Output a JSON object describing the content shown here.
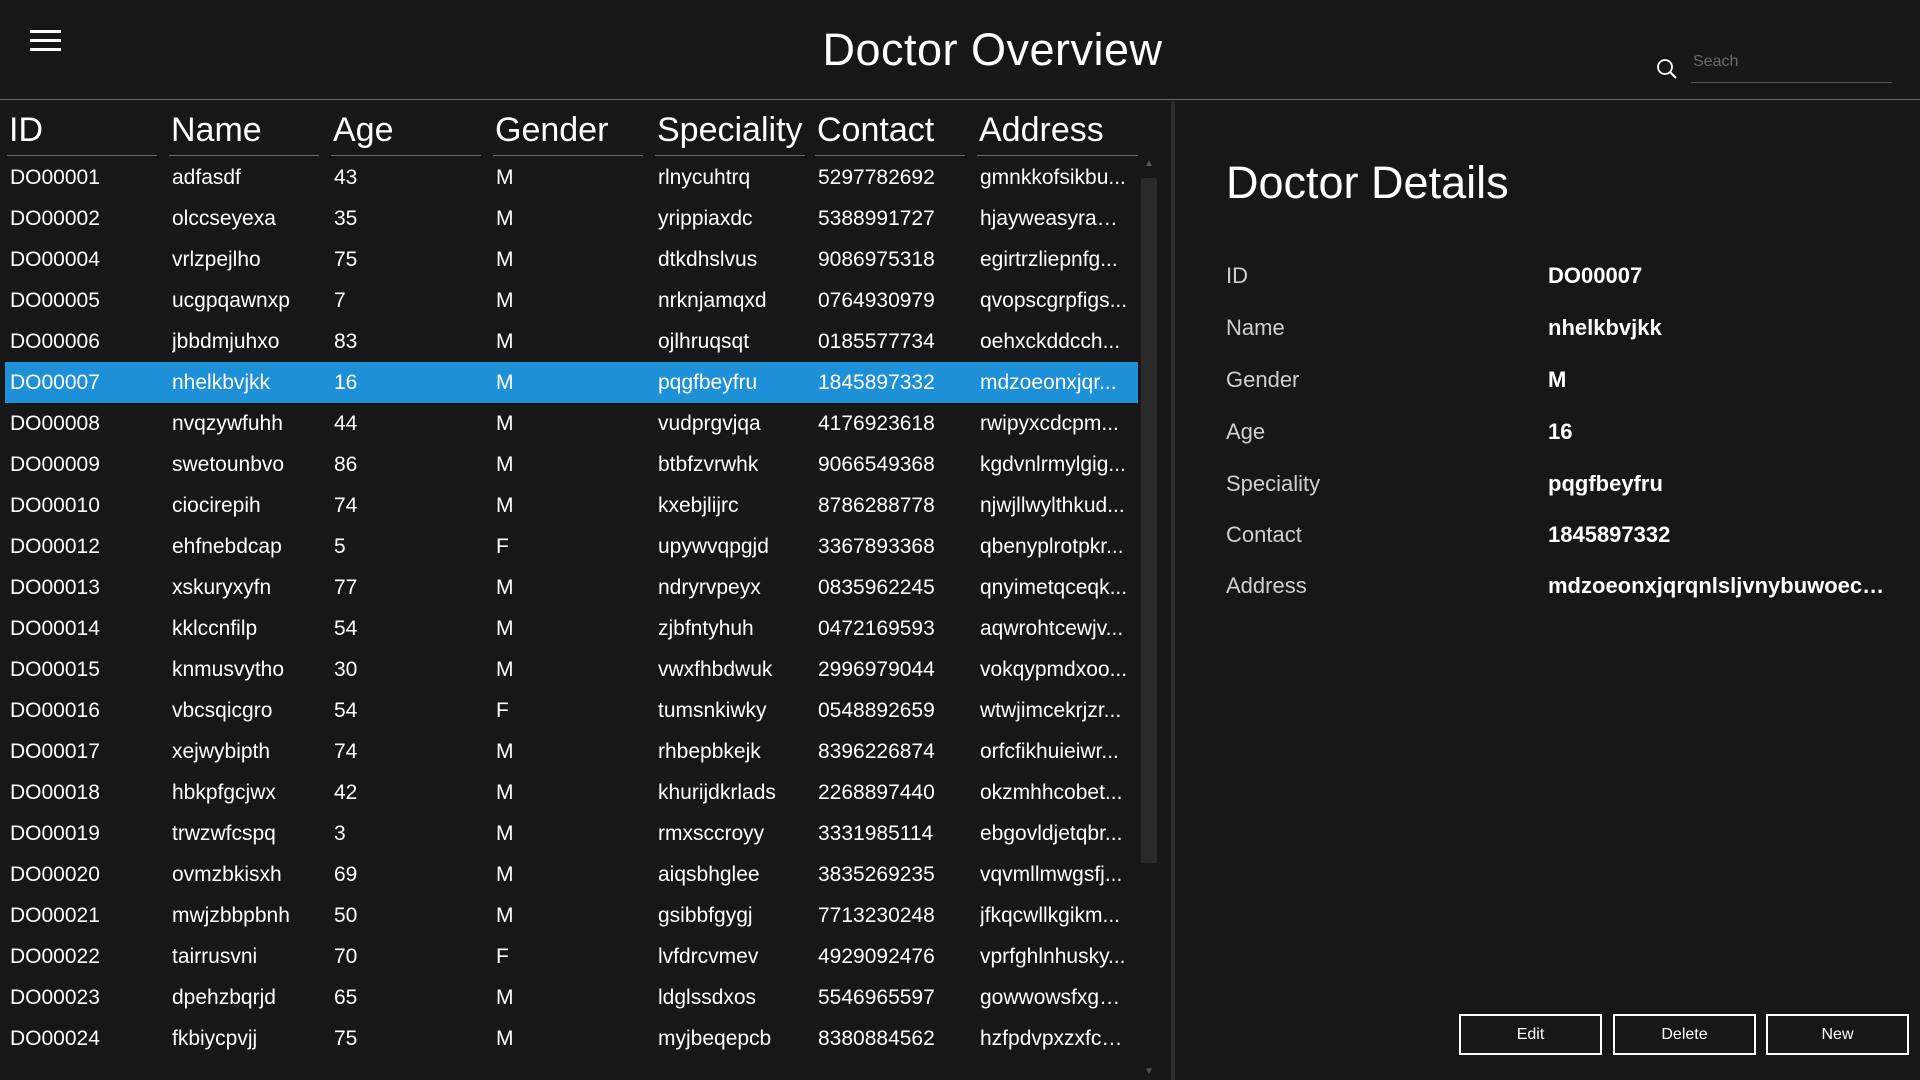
{
  "header": {
    "title": "Doctor Overview",
    "search_placeholder": "Seach"
  },
  "table": {
    "columns": [
      "ID",
      "Name",
      "Age",
      "Gender",
      "Speciality",
      "Contact",
      "Address"
    ],
    "selected_id": "DO00007",
    "rows": [
      [
        "DO00001",
        "adfasdf",
        "43",
        "M",
        "rlnycuhtrq",
        "5297782692",
        "gmnkkofsikbu..."
      ],
      [
        "DO00002",
        "olccseyexa",
        "35",
        "M",
        "yrippiaxdc",
        "5388991727",
        "hjayweasyragj..."
      ],
      [
        "DO00004",
        "vrlzpejlho",
        "75",
        "M",
        "dtkdhslvus",
        "9086975318",
        "egirtrzliepnfg..."
      ],
      [
        "DO00005",
        "ucgpqawnxp",
        "7",
        "M",
        "nrknjamqxd",
        "0764930979",
        "qvopscgrpfigs..."
      ],
      [
        "DO00006",
        "jbbdmjuhxo",
        "83",
        "M",
        "ojlhruqsqt",
        "0185577734",
        "oehxckddcch..."
      ],
      [
        "DO00007",
        "nhelkbvjkk",
        "16",
        "M",
        "pqgfbeyfru",
        "1845897332",
        "mdzoeonxjqr..."
      ],
      [
        "DO00008",
        "nvqzywfuhh",
        "44",
        "M",
        "vudprgvjqa",
        "4176923618",
        "rwipyxcdcpm..."
      ],
      [
        "DO00009",
        "swetounbvo",
        "86",
        "M",
        "btbfzvrwhk",
        "9066549368",
        "kgdvnlrmylgig..."
      ],
      [
        "DO00010",
        "ciocirepih",
        "74",
        "M",
        "kxebjlijrc",
        "8786288778",
        "njwjllwylthkud..."
      ],
      [
        "DO00012",
        "ehfnebdcap",
        "5",
        "F",
        "upywvqpgjd",
        "3367893368",
        "qbenyplrotpkr..."
      ],
      [
        "DO00013",
        "xskuryxyfn",
        "77",
        "M",
        "ndryrvpeyx",
        "0835962245",
        "qnyimetqceqk..."
      ],
      [
        "DO00014",
        "kklccnfilp",
        "54",
        "M",
        "zjbfntyhuh",
        "0472169593",
        "aqwrohtcewjv..."
      ],
      [
        "DO00015",
        "knmusvytho",
        "30",
        "M",
        "vwxfhbdwuk",
        "2996979044",
        "vokqypmdxoo..."
      ],
      [
        "DO00016",
        "vbcsqicgro",
        "54",
        "F",
        "tumsnkiwky",
        "0548892659",
        "wtwjimcekrjzr..."
      ],
      [
        "DO00017",
        "xejwybipth",
        "74",
        "M",
        "rhbepbkejk",
        "8396226874",
        "orfcfikhuieiwr..."
      ],
      [
        "DO00018",
        "hbkpfgcjwx",
        "42",
        "M",
        "khurijdkrlads",
        "2268897440",
        "okzmhhcobet..."
      ],
      [
        "DO00019",
        "trwzwfcspq",
        "3",
        "M",
        "rmxsccroyy",
        "3331985114",
        "ebgovldjetqbr..."
      ],
      [
        "DO00020",
        "ovmzbkisxh",
        "69",
        "M",
        "aiqsbhglee",
        "3835269235",
        "vqvmllmwgsfj..."
      ],
      [
        "DO00021",
        "mwjzbbpbnh",
        "50",
        "M",
        "gsibbfgygj",
        "7713230248",
        "jfkqcwllkgikm..."
      ],
      [
        "DO00022",
        "tairrusvni",
        "70",
        "F",
        "lvfdrcvmev",
        "4929092476",
        "vprfghlnhusky..."
      ],
      [
        "DO00023",
        "dpehzbqrjd",
        "65",
        "M",
        "ldglssdxos",
        "5546965597",
        "gowwowsfxgh..."
      ],
      [
        "DO00024",
        "fkbiycpvjj",
        "75",
        "M",
        "myjbeqepcb",
        "8380884562",
        "hzfpdvpxzxfce..."
      ]
    ]
  },
  "details": {
    "title": "Doctor Details",
    "fields": [
      {
        "label": "ID",
        "value": "DO00007"
      },
      {
        "label": "Name",
        "value": "nhelkbvjkk"
      },
      {
        "label": "Gender",
        "value": "M"
      },
      {
        "label": "Age",
        "value": "16"
      },
      {
        "label": "Speciality",
        "value": "pqgfbeyfru"
      },
      {
        "label": "Contact",
        "value": "1845897332"
      },
      {
        "label": "Address",
        "value": "mdzoeonxjqrqnlsljvnybuwoecq..."
      }
    ]
  },
  "buttons": {
    "edit": "Edit",
    "delete": "Delete",
    "new": "New"
  },
  "colors": {
    "background": "#171717",
    "selection": "#1e90d8",
    "divider": "#6a6a6a"
  },
  "icons": [
    "hamburger-menu-icon",
    "search-icon",
    "scroll-up-icon",
    "scroll-down-icon"
  ]
}
